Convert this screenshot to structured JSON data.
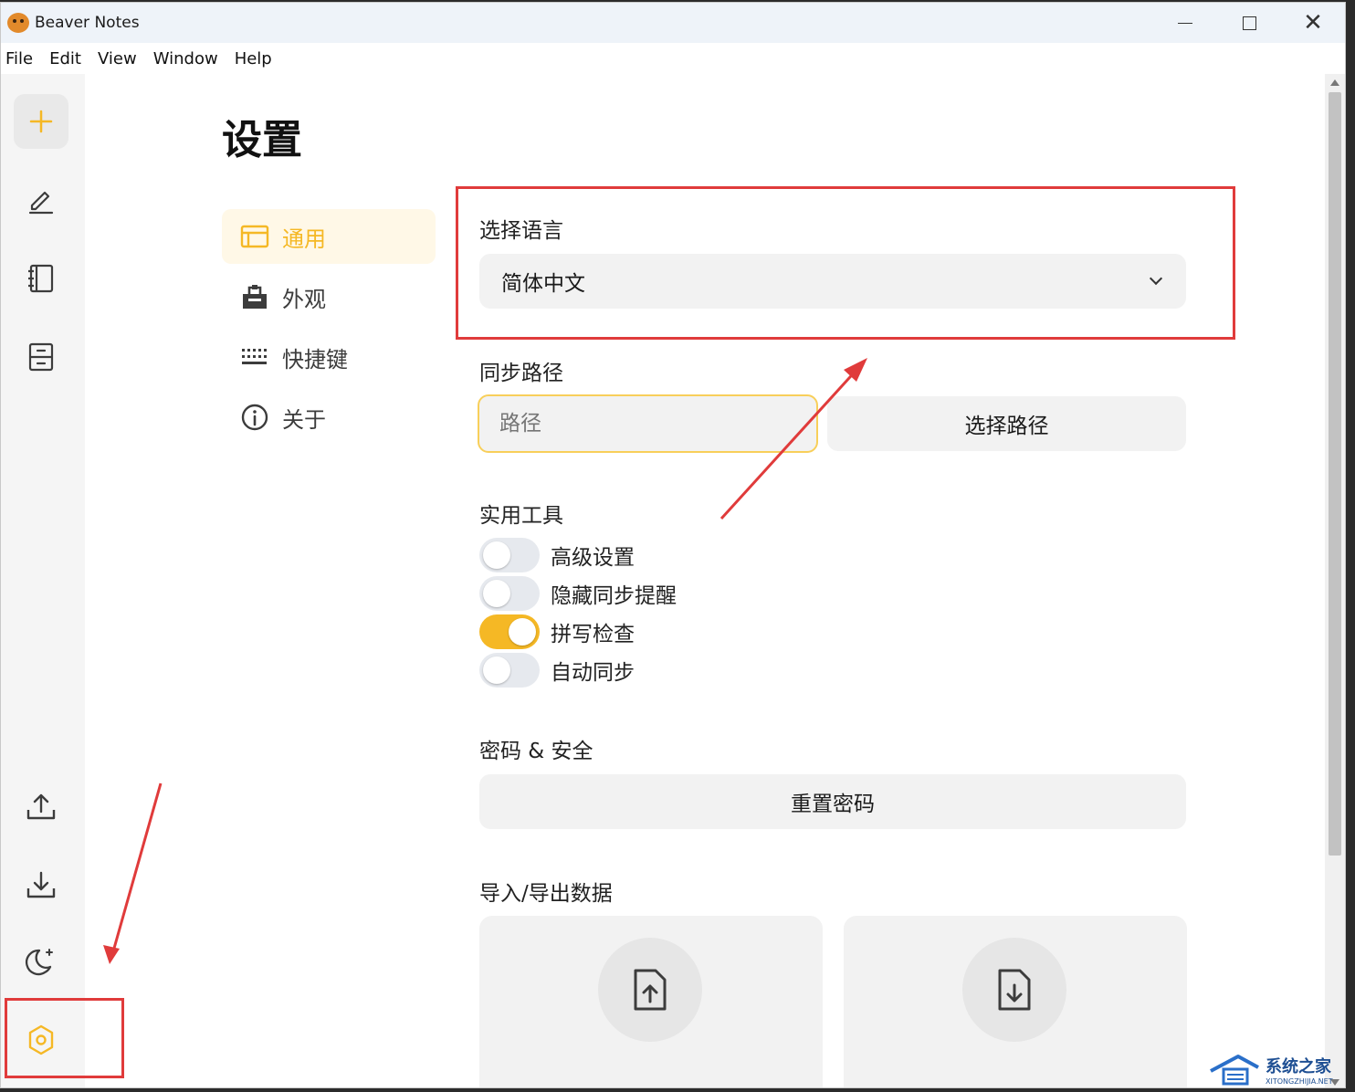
{
  "window": {
    "title": "Beaver Notes"
  },
  "menu": [
    "File",
    "Edit",
    "View",
    "Window",
    "Help"
  ],
  "sidebar": {
    "top_icons": [
      "plus-icon",
      "edit-icon",
      "notebook-icon",
      "archive-icon"
    ],
    "bottom_icons": [
      "upload-icon",
      "download-icon",
      "moon-stars-icon",
      "settings-icon"
    ]
  },
  "page": {
    "title": "设置"
  },
  "settings_nav": [
    {
      "label": "通用",
      "icon": "window-icon",
      "active": true
    },
    {
      "label": "外观",
      "icon": "palette-icon",
      "active": false
    },
    {
      "label": "快捷键",
      "icon": "keyboard-icon",
      "active": false
    },
    {
      "label": "关于",
      "icon": "info-icon",
      "active": false
    }
  ],
  "language": {
    "label": "选择语言",
    "selected": "简体中文"
  },
  "sync": {
    "label": "同步路径",
    "placeholder": "路径",
    "button": "选择路径"
  },
  "utilities": {
    "label": "实用工具",
    "toggles": [
      {
        "label": "高级设置",
        "on": false
      },
      {
        "label": "隐藏同步提醒",
        "on": false
      },
      {
        "label": "拼写检查",
        "on": true
      },
      {
        "label": "自动同步",
        "on": false
      }
    ]
  },
  "security": {
    "label": "密码 & 安全",
    "button": "重置密码"
  },
  "import_export": {
    "label": "导入/导出数据"
  },
  "watermark": {
    "main": "系统之家",
    "sub": "XITONGZHIJIA.NET"
  },
  "colors": {
    "accent": "#f5b825",
    "annotation": "#e03b3b"
  }
}
